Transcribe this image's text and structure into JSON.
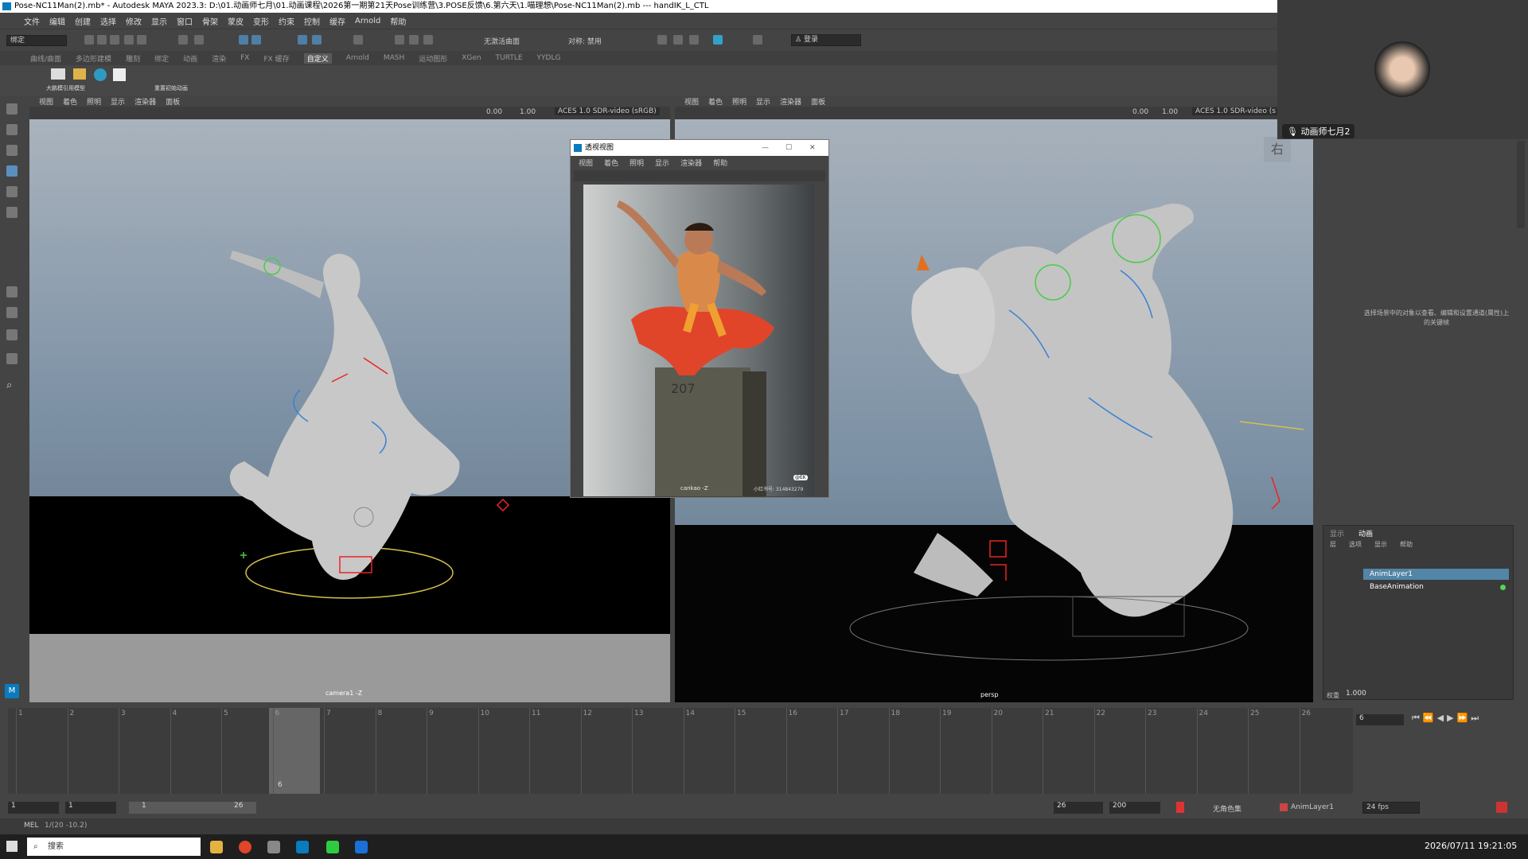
{
  "window": {
    "title": "Pose-NC11Man(2).mb* - Autodesk MAYA 2023.3: D:\\01.动画师七月\\01.动画课程\\2026第一期第21天Pose训练营\\3.POSE反馈\\6.第六天\\1.喵理想\\Pose-NC11Man(2).mb --- handIK_L_CTL"
  },
  "menubar": [
    "文件",
    "编辑",
    "创建",
    "选择",
    "修改",
    "显示",
    "窗口",
    "骨架",
    "蒙皮",
    "变形",
    "约束",
    "控制",
    "缓存",
    "Arnold",
    "帮助"
  ],
  "statusline": {
    "mode_combo": "绑定",
    "live_surface": "无激活曲面",
    "symmetry": "对称: 禁用",
    "login": "登录"
  },
  "shelf_tabs": [
    {
      "label": "曲线/曲面",
      "active": false
    },
    {
      "label": "多边形建模",
      "active": false
    },
    {
      "label": "雕刻",
      "active": false
    },
    {
      "label": "绑定",
      "active": false
    },
    {
      "label": "动画",
      "active": false
    },
    {
      "label": "渲染",
      "active": false
    },
    {
      "label": "FX",
      "active": false
    },
    {
      "label": "FX 缓存",
      "active": false
    },
    {
      "label": "自定义",
      "active": true
    },
    {
      "label": "Arnold",
      "active": false
    },
    {
      "label": "MASH",
      "active": false
    },
    {
      "label": "运动图形",
      "active": false
    },
    {
      "label": "XGen",
      "active": false
    },
    {
      "label": "TURTLE",
      "active": false
    },
    {
      "label": "YYDLG",
      "active": false
    }
  ],
  "shelf_items": [
    "大鹏模引用模型",
    "重置初始动画"
  ],
  "viewport_menu": [
    "视图",
    "着色",
    "照明",
    "显示",
    "渲染器",
    "面板"
  ],
  "viewport_left": {
    "camera": "camera1 -Z",
    "color_space": "ACES 1.0 SDR-video (sRGB)",
    "field1": "0.00",
    "field2": "1.00"
  },
  "viewport_right": {
    "camera": "persp",
    "color_space": "ACES 1.0 SDR-video (s",
    "field1": "0.00",
    "field2": "1.00",
    "view_cube_label": "右"
  },
  "ref_window": {
    "title": "透视视图",
    "menu": [
      "视图",
      "着色",
      "照明",
      "显示",
      "渲染器",
      "帮助"
    ],
    "caption": "cankao -Z",
    "watermark": "小红书号: 314843279",
    "tag": "@EK",
    "box_text": "207"
  },
  "video_call": {
    "name": "动画师七月2"
  },
  "channel_hint": "选择场景中的对象以查看、编辑和设置通道(属性)上的关键帧",
  "layer_panel": {
    "tabs": [
      "显示",
      "动画"
    ],
    "menu": [
      "层",
      "选项",
      "显示",
      "帮助"
    ],
    "layers": [
      "AnimLayer1",
      "BaseAnimation"
    ],
    "weight_label": "权重",
    "weight": "1.000"
  },
  "timeline": {
    "ticks": [
      "1",
      "2",
      "3",
      "4",
      "5",
      "6",
      "7",
      "8",
      "9",
      "10",
      "11",
      "12",
      "13",
      "14",
      "15",
      "16",
      "17",
      "18",
      "19",
      "20",
      "21",
      "22",
      "23",
      "24",
      "25",
      "26"
    ],
    "current_frame": "6",
    "current_field": "6"
  },
  "range": {
    "start": "1",
    "start2": "1",
    "slider_start": "1",
    "slider_end": "26",
    "end": "26",
    "end2": "200",
    "char_set": "无角色集",
    "anim_layer": "AnimLayer1",
    "fps": "24 fps"
  },
  "cmdline": {
    "label": "MEL",
    "coords": "1/(20 -10.2)"
  },
  "taskbar": {
    "search": "搜索",
    "datetime": "2026/07/11 19:21:05"
  }
}
